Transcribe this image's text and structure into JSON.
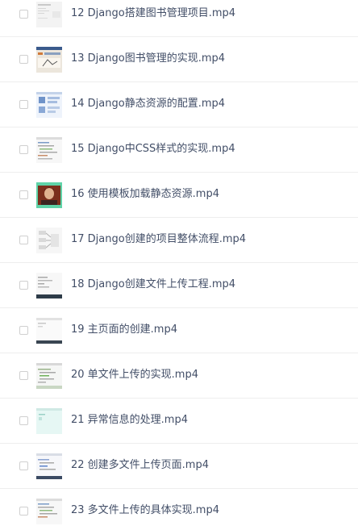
{
  "files": [
    {
      "name": "12 Django搭建图书管理项目.mp4",
      "thumb": "doc-light-icon"
    },
    {
      "name": "13 Django图书管理的实现.mp4",
      "thumb": "browser-page-icon"
    },
    {
      "name": "14 Django静态资源的配置.mp4",
      "thumb": "blue-diagram-icon"
    },
    {
      "name": "15 Django中CSS样式的实现.mp4",
      "thumb": "code-editor-icon"
    },
    {
      "name": "16 使用模板加载静态资源.mp4",
      "thumb": "presenter-photo-icon"
    },
    {
      "name": "17 Django创建的项目整体流程.mp4",
      "thumb": "flow-diagram-icon"
    },
    {
      "name": "18 Django创建文件上传工程.mp4",
      "thumb": "ide-dark-bar-icon"
    },
    {
      "name": "19 主页面的创建.mp4",
      "thumb": "blank-page-icon"
    },
    {
      "name": "20 单文件上传的实现.mp4",
      "thumb": "code-green-icon"
    },
    {
      "name": "21 异常信息的处理.mp4",
      "thumb": "light-cyan-page-icon"
    },
    {
      "name": "22 创建多文件上传页面.mp4",
      "thumb": "code-blue-icon"
    },
    {
      "name": "23 多文件上传的具体实现.mp4",
      "thumb": "code-editor-icon"
    }
  ]
}
